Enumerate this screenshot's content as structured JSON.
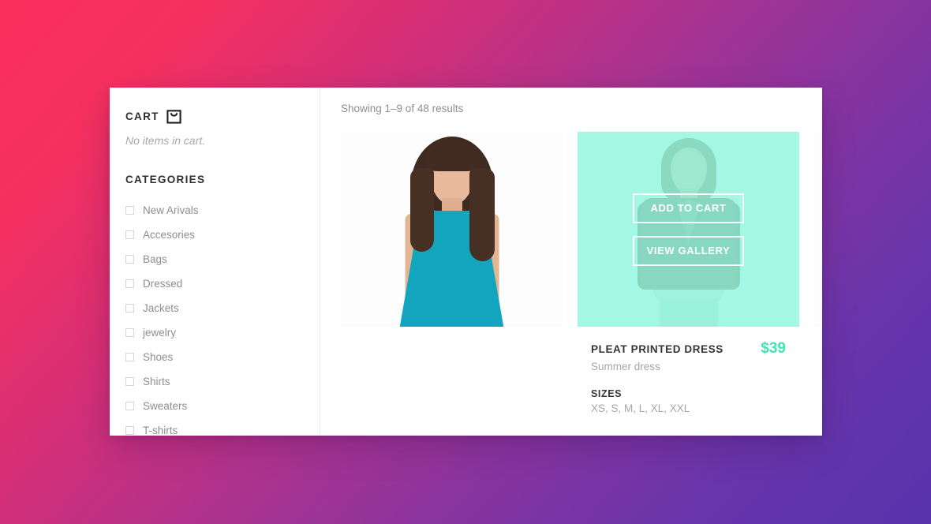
{
  "sidebar": {
    "cart": {
      "title": "CART",
      "icon": "shopping-bag-icon",
      "empty_message": "No items in cart."
    },
    "categories": {
      "title": "CATEGORIES",
      "items": [
        {
          "label": "New Arivals",
          "checked": false
        },
        {
          "label": "Accesories",
          "checked": false
        },
        {
          "label": "Bags",
          "checked": false
        },
        {
          "label": "Dressed",
          "checked": false
        },
        {
          "label": "Jackets",
          "checked": false
        },
        {
          "label": "jewelry",
          "checked": false
        },
        {
          "label": "Shoes",
          "checked": false
        },
        {
          "label": "Shirts",
          "checked": false
        },
        {
          "label": "Sweaters",
          "checked": false
        },
        {
          "label": "T-shirts",
          "checked": false
        }
      ]
    }
  },
  "main": {
    "results_text": "Showing 1–9 of 48 results",
    "products": [
      {
        "name": "",
        "subtitle": "",
        "price": "",
        "sizes_label": "",
        "sizes_value": "",
        "hovered": false
      },
      {
        "name": "PLEAT PRINTED DRESS",
        "subtitle": "Summer dress",
        "price": "$39",
        "sizes_label": "SIZES",
        "sizes_value": "XS, S, M, L, XL, XXL",
        "hovered": true,
        "overlay": {
          "add_to_cart_label": "ADD TO CART",
          "view_gallery_label": "VIEW GALLERY"
        }
      },
      {
        "name": "",
        "subtitle": "",
        "price": "",
        "sizes_label": "",
        "sizes_value": "",
        "hovered": false
      }
    ]
  },
  "colors": {
    "background_start": "#fb2f5c",
    "background_end": "#5733ad",
    "accent_mint": "#3ee6b0",
    "overlay_mint": "#8df5dc",
    "panel": "#ffffff",
    "text_dark": "#34343a",
    "text_muted": "#8e8e8e"
  }
}
